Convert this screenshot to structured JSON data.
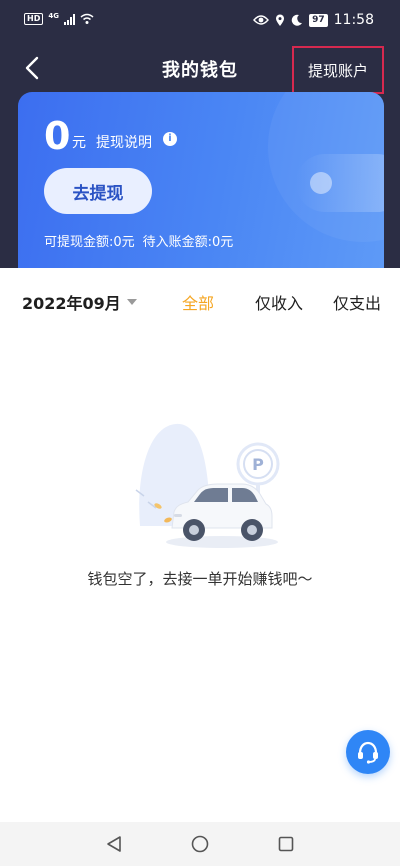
{
  "status_bar": {
    "hd": "HD",
    "network": "4G",
    "battery": "97",
    "time": "11:58"
  },
  "header": {
    "title": "我的钱包",
    "action_label": "提现账户",
    "action_highlight_color": "#d6294f"
  },
  "wallet": {
    "balance": "0",
    "unit": "元",
    "info_label": "提现说明",
    "info_icon": "info-icon",
    "withdraw_button": "去提现",
    "withdrawable": "可提现金额:0元",
    "pending": "待入账金额:0元"
  },
  "filter": {
    "date": "2022年09月",
    "tabs": [
      {
        "label": "全部",
        "active": true
      },
      {
        "label": "仅收入",
        "active": false
      },
      {
        "label": "仅支出",
        "active": false
      }
    ],
    "active_color": "#f5a623"
  },
  "empty_state": {
    "message": "钱包空了，去接一单开始赚钱吧～",
    "illustration": "car-parking-illustration",
    "parking_sign": "P"
  },
  "fab": {
    "icon": "customer-service-icon",
    "color": "#2f86f6"
  },
  "system_nav": {
    "back": "triangle-back-icon",
    "home": "circle-home-icon",
    "recent": "square-recent-icon"
  },
  "colors": {
    "header_bg": "#2b2d44",
    "card_gradient_start": "#3c6ef0",
    "card_gradient_end": "#5e9af7"
  }
}
